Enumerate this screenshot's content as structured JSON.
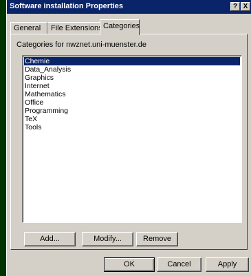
{
  "window": {
    "title": "Software installation Properties"
  },
  "titlebar_buttons": {
    "help": "?",
    "close": "X"
  },
  "tabs": [
    {
      "label": "General"
    },
    {
      "label": "File Extensions"
    },
    {
      "label": "Categories"
    }
  ],
  "categories": {
    "label": "Categories for nwznet.uni-muenster.de",
    "items": [
      "Chemie",
      "Data_Analysis",
      "Graphics",
      "Internet",
      "Mathematics",
      "Office",
      "Programming",
      "TeX",
      "Tools"
    ],
    "selected": "Chemie",
    "buttons": {
      "add": "Add...",
      "modify": "Modify...",
      "remove": "Remove"
    }
  },
  "footer": {
    "ok": "OK",
    "cancel": "Cancel",
    "apply": "Apply"
  }
}
